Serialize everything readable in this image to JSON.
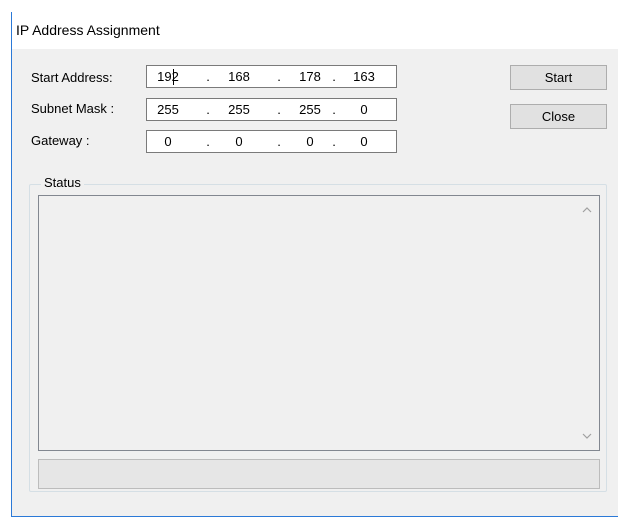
{
  "window": {
    "title": "IP Address Assignment"
  },
  "form": {
    "start_address": {
      "label": "Start Address:",
      "octets": [
        "192",
        "168",
        "178",
        "163"
      ]
    },
    "subnet_mask": {
      "label": "Subnet Mask :",
      "octets": [
        "255",
        "255",
        "255",
        "0"
      ]
    },
    "gateway": {
      "label": "Gateway :",
      "octets": [
        "0",
        "0",
        "0",
        "0"
      ]
    },
    "separator": "."
  },
  "buttons": {
    "start_label": "Start",
    "close_label": "Close"
  },
  "status": {
    "legend": "Status",
    "log_text": ""
  },
  "progress": {
    "value": 0
  },
  "icons": {
    "scroll_up": "chevron-up-icon",
    "scroll_down": "chevron-down-icon"
  },
  "colors": {
    "window_border": "#2b79d7",
    "background": "#f0f0f0"
  }
}
